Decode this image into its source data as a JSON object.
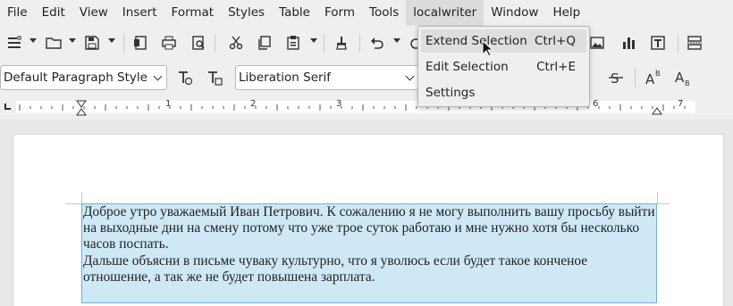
{
  "menubar": {
    "items": [
      "File",
      "Edit",
      "View",
      "Insert",
      "Format",
      "Styles",
      "Table",
      "Form",
      "Tools",
      "localwriter",
      "Window",
      "Help"
    ],
    "active": "localwriter"
  },
  "toolbar": {
    "icons": [
      "new-document-icon",
      "open-icon",
      "save-icon",
      "export-pdf-icon",
      "print-icon",
      "print-preview-icon",
      "cut-icon",
      "copy-icon",
      "paste-icon",
      "clone-formatting-icon",
      "undo-icon",
      "redo-icon",
      "insert-image-icon",
      "insert-chart-icon",
      "insert-text-box-icon",
      "page-break-icon"
    ]
  },
  "formatting": {
    "paragraph_style": "Default Paragraph Style",
    "font_name": "Liberation Serif",
    "icons": [
      "update-style-icon",
      "new-style-icon",
      "strikethrough-icon",
      "superscript-icon",
      "subscript-icon"
    ]
  },
  "ruler": {
    "numbers": [
      "1",
      "2",
      "3",
      "4",
      "5",
      "6",
      "7"
    ]
  },
  "document": {
    "paragraph1": "Доброе утро уважаемый Иван Петрович. К сожалению я не могу выполнить вашу просьбу выйти на выходные дни на смену потому что уже трое суток работаю и мне нужно хотя бы несколько часов поспать.",
    "paragraph2": "Дальше объясни в письме чуваку культурно, что я уволюсь если будет такое конченое отношение, а так же не будет повышена зарплата."
  },
  "dropdown": {
    "items": [
      {
        "label": "Extend Selection",
        "shortcut": "Ctrl+Q"
      },
      {
        "label": "Edit Selection",
        "shortcut": "Ctrl+E"
      },
      {
        "label": "Settings",
        "shortcut": ""
      }
    ]
  },
  "colors": {
    "selection": "#cfe8f6",
    "selection_border": "#6ab0d8",
    "menu_bg": "#efefef"
  }
}
